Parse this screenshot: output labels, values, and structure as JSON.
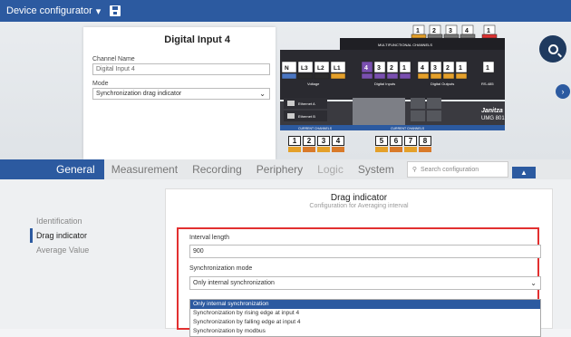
{
  "topbar": {
    "title": "Device configurator",
    "caret": "▾",
    "save_icon": "save-icon"
  },
  "card": {
    "title": "Digital Input 4",
    "channel_name_label": "Channel Name",
    "channel_name_value": "Digital Input 4",
    "mode_label": "Mode",
    "mode_value": "Synchronization drag indicator"
  },
  "device": {
    "top_numbers": [
      "1",
      "2",
      "3",
      "4",
      "1"
    ],
    "multifunction_label": "MULTIFUNCTIONAL CHANNELS",
    "analog_label": "Analog Output",
    "voltage_terms": [
      "N",
      "L3",
      "L2",
      "L1"
    ],
    "voltage_label": "Voltage",
    "digital_inputs": [
      "4",
      "3",
      "2",
      "1"
    ],
    "digital_inputs_label": "Digital Inputs",
    "digital_outputs": [
      "4",
      "3",
      "2",
      "1"
    ],
    "digital_outputs_label": "Digital Outputs",
    "rs485_num": "1",
    "rs485_label": "RS-485",
    "ethernet_a": "Ethernet A",
    "ethernet_b": "Ethernet B",
    "current_label": "CURRENT CHANNELS",
    "current_nums_left": [
      "1",
      "2",
      "3",
      "4"
    ],
    "current_nums_right": [
      "5",
      "6",
      "7",
      "8"
    ],
    "brand": "Janitza",
    "model": "UMG 801"
  },
  "tabs": [
    {
      "label": "General",
      "state": "active"
    },
    {
      "label": "Measurement",
      "state": "normal"
    },
    {
      "label": "Recording",
      "state": "normal"
    },
    {
      "label": "Periphery",
      "state": "normal"
    },
    {
      "label": "Logic",
      "state": "dim"
    },
    {
      "label": "System",
      "state": "normal"
    }
  ],
  "search": {
    "placeholder": "Search configuration"
  },
  "side_nav": [
    "Identification",
    "Drag indicator",
    "Average Value"
  ],
  "panel": {
    "title": "Drag indicator",
    "subtitle": "Configuration for Averaging interval",
    "interval_label": "Interval length",
    "interval_value": "900",
    "sync_label": "Synchronization mode",
    "sync_value": "Only internal synchronization",
    "options": [
      "Only internal synchronization",
      "Synchronization by rising edge at input 4",
      "Synchronization by falling edge at input 4",
      "Synchronization by modbus"
    ]
  },
  "colors": {
    "accent": "#2c5aa0",
    "highlight": "#e23030"
  }
}
